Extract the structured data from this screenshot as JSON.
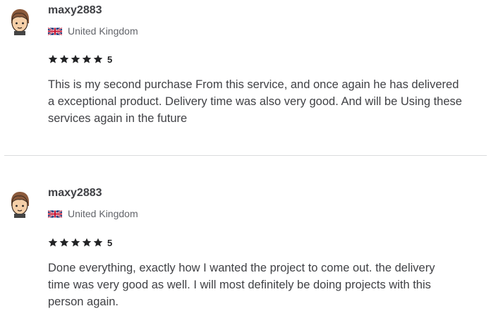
{
  "reviews": [
    {
      "username": "maxy2883",
      "country": "United Kingdom",
      "rating": "5",
      "stars": 5,
      "text_lines": [
        "This is my second purchase From this service, and once again he has delivered",
        "a exceptional product. Delivery time was also very good. And will be Using these",
        "services again in the future"
      ]
    },
    {
      "username": "maxy2883",
      "country": "United Kingdom",
      "rating": "5",
      "stars": 5,
      "text_lines": [
        "Done everything, exactly how I wanted the project to come out. the delivery",
        "time was very good as well. I will most definitely be doing projects with this",
        "person again."
      ]
    }
  ],
  "colors": {
    "star": "#222325",
    "text": "#404145",
    "divider": "#dadbdd"
  }
}
